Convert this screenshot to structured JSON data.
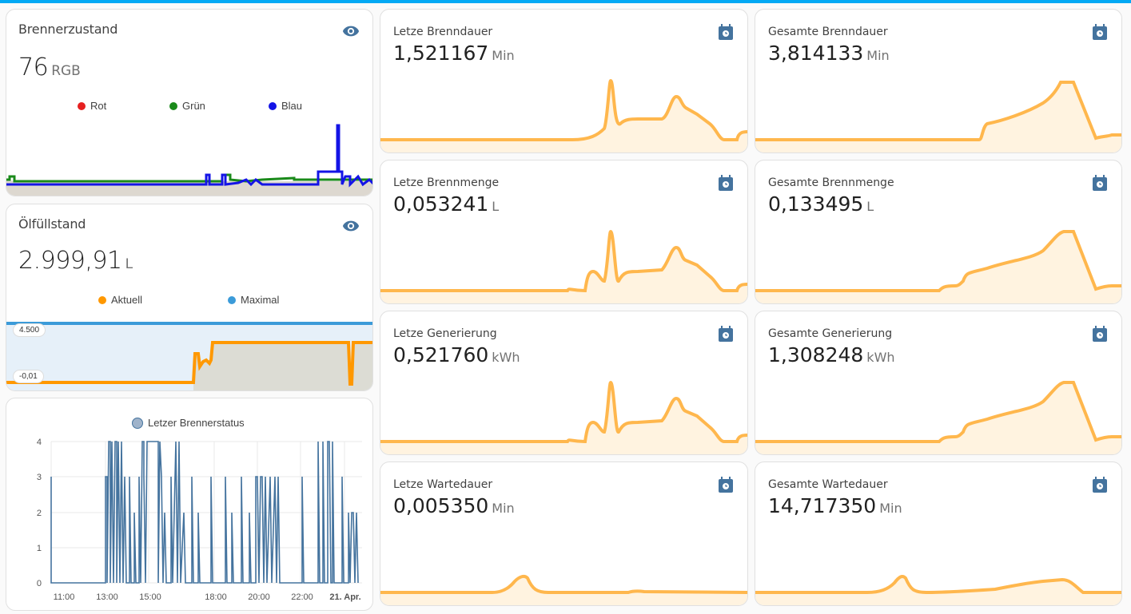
{
  "brenner": {
    "title": "Brennerzustand",
    "value": "76",
    "unit": "RGB",
    "legend": [
      {
        "label": "Rot",
        "color": "#e62020"
      },
      {
        "label": "Grün",
        "color": "#1a8a1a"
      },
      {
        "label": "Blau",
        "color": "#1414e6"
      }
    ]
  },
  "oel": {
    "title": "Ölfüllstand",
    "value": "2.999,91",
    "unit": "L",
    "legend": [
      {
        "label": "Aktuell",
        "color": "#ff9800"
      },
      {
        "label": "Maximal",
        "color": "#3b9bd9"
      }
    ],
    "badge_top": "4.500",
    "badge_bottom": "-0,01"
  },
  "status_chart": {
    "legend": "Letzer Brennerstatus",
    "y_ticks": [
      "4",
      "3",
      "2",
      "1",
      "0"
    ],
    "x_ticks": [
      "11:00",
      "13:00",
      "15:00",
      "18:00",
      "20:00",
      "22:00",
      "21. Apr."
    ]
  },
  "sensors": [
    {
      "title": "Letze Brenndauer",
      "value": "1,521167",
      "unit": "Min"
    },
    {
      "title": "Gesamte Brenndauer",
      "value": "3,814133",
      "unit": "Min"
    },
    {
      "title": "Letze Brennmenge",
      "value": "0,053241",
      "unit": "L"
    },
    {
      "title": "Gesamte Brennmenge",
      "value": "0,133495",
      "unit": "L"
    },
    {
      "title": "Letze Generierung",
      "value": "0,521760",
      "unit": "kWh"
    },
    {
      "title": "Gesamte Generierung",
      "value": "1,308248",
      "unit": "kWh"
    },
    {
      "title": "Letze Wartedauer",
      "value": "0,005350",
      "unit": "Min"
    },
    {
      "title": "Gesamte Wartedauer",
      "value": "14,717350",
      "unit": "Min"
    }
  ],
  "colors": {
    "accent": "#03a9f4",
    "spark_line": "#ffb74d",
    "spark_fill": "#fff3e0",
    "icon": "#44739e"
  }
}
